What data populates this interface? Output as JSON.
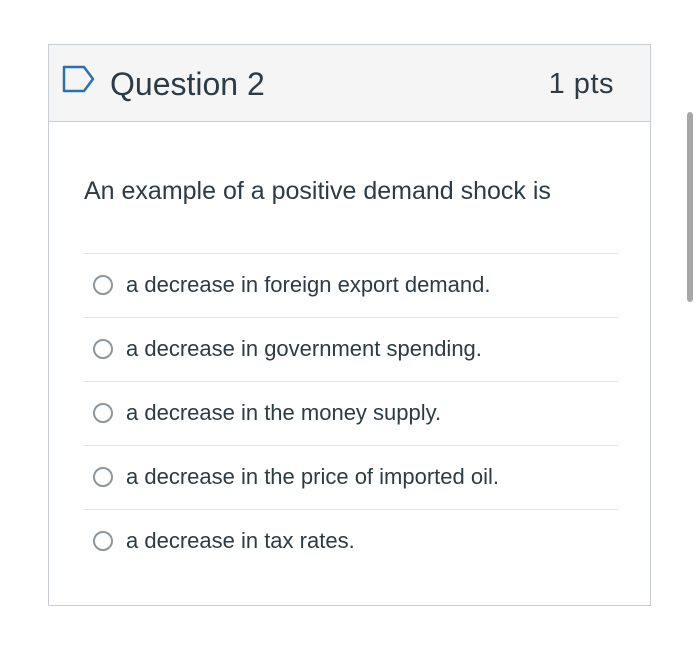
{
  "question": {
    "title": "Question 2",
    "points": "1 pts",
    "text": "An example of a positive demand shock is",
    "flag_icon": "flag-outline-icon",
    "accent_color": "#2b6fb3"
  },
  "answers": [
    {
      "label": "a decrease in foreign export demand.",
      "selected": false
    },
    {
      "label": "a decrease in government spending.",
      "selected": false
    },
    {
      "label": "a decrease in the money supply.",
      "selected": false
    },
    {
      "label": "a decrease in the price of imported oil.",
      "selected": false
    },
    {
      "label": "a decrease in tax rates.",
      "selected": false
    }
  ]
}
